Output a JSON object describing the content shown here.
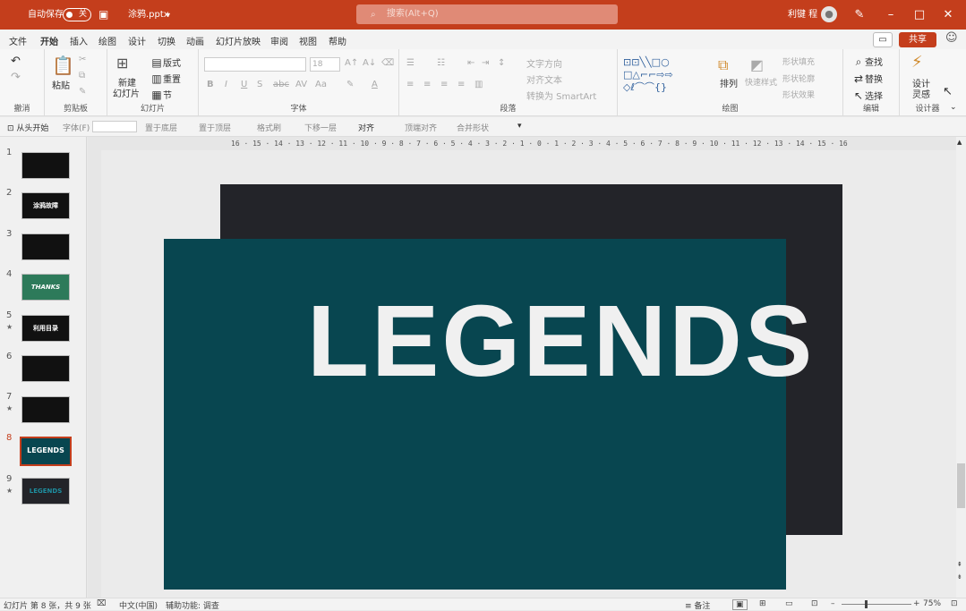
{
  "titlebar": {
    "autosave_label": "自动保存",
    "autosave_state": "关",
    "filename": "涂鸦.pptx",
    "search_placeholder": "搜索(Alt+Q)",
    "user_name": "利键 程"
  },
  "menu": [
    "文件",
    "开始",
    "插入",
    "绘图",
    "设计",
    "切换",
    "动画",
    "幻灯片放映",
    "审阅",
    "视图",
    "帮助"
  ],
  "share_label": "共享",
  "ribbon": {
    "undo_group": "撤消",
    "clipboard": {
      "paste": "粘贴",
      "label": "剪贴板"
    },
    "slides": {
      "new_slide_1": "新建",
      "new_slide_2": "幻灯片",
      "layout": "版式",
      "reset": "重置",
      "section": "节",
      "label": "幻灯片"
    },
    "font": {
      "size": "18",
      "label": "字体",
      "bold": "B",
      "italic": "I",
      "underline": "U",
      "strike": "S",
      "shadow": "abc"
    },
    "paragraph": {
      "text_direction": "文字方向",
      "align_text": "对齐文本",
      "smartart": "转换为 SmartArt",
      "label": "段落"
    },
    "drawing": {
      "arrange": "排列",
      "quick_styles": "快速样式",
      "shape_fill": "形状填充",
      "shape_outline": "形状轮廓",
      "shape_effects": "形状效果",
      "label": "绘图"
    },
    "editing": {
      "find": "查找",
      "replace": "替换",
      "select": "选择",
      "label": "编辑"
    },
    "designer": {
      "line1": "设计",
      "line2": "灵感",
      "label": "设计器"
    }
  },
  "quick_access": {
    "from_start": "从头开始",
    "font": "字体(F)",
    "send_to_back": "置于底层",
    "bring_to_front": "置于顶层",
    "format_painter": "格式刷",
    "send_backward": "下移一层",
    "align": "对齐",
    "align_top": "顶端对齐",
    "merge_shapes": "合并形状"
  },
  "slides": [
    {
      "num": "1",
      "star": "",
      "label": ""
    },
    {
      "num": "2",
      "star": "",
      "label": "涂鸦故障"
    },
    {
      "num": "3",
      "star": "",
      "label": ""
    },
    {
      "num": "4",
      "star": "",
      "label": "THANKS"
    },
    {
      "num": "5",
      "star": "★",
      "label": "利用目录"
    },
    {
      "num": "6",
      "star": "",
      "label": ""
    },
    {
      "num": "7",
      "star": "★",
      "label": ""
    },
    {
      "num": "8",
      "star": "",
      "label": "LEGENDS"
    },
    {
      "num": "9",
      "star": "★",
      "label": "LEGENDS"
    }
  ],
  "slide_text": "LEGENDS",
  "ruler_text": "16 · 15 · 14 · 13 · 12 · 11 · 10 · 9 · 8 · 7 · 6 · 5 · 4 · 3 · 2 · 1 · 0 · 1 · 2 · 3 · 4 · 5 · 6 · 7 · 8 · 9 · 10 · 11 · 12 · 13 · 14 · 15 · 16",
  "status": {
    "slide_info": "幻灯片 第 8 张，共 9 张",
    "language": "中文(中国)",
    "accessibility": "辅助功能: 调查",
    "notes": "备注",
    "zoom": "75%"
  },
  "colors": {
    "accent": "#c43e1c",
    "slide_front": "#084650",
    "slide_back": "#232429"
  }
}
